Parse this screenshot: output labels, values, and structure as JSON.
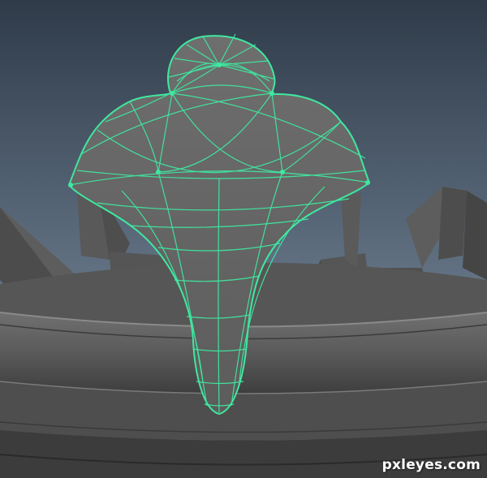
{
  "watermark": {
    "text": "pxleyes.com"
  },
  "colors": {
    "background_top": "#2f3b49",
    "background_bottom": "#7d8da0",
    "wireframe": "#3fe8a0",
    "mesh_fill": "#6b6b6b",
    "crown_band": "#5e5e5e"
  }
}
